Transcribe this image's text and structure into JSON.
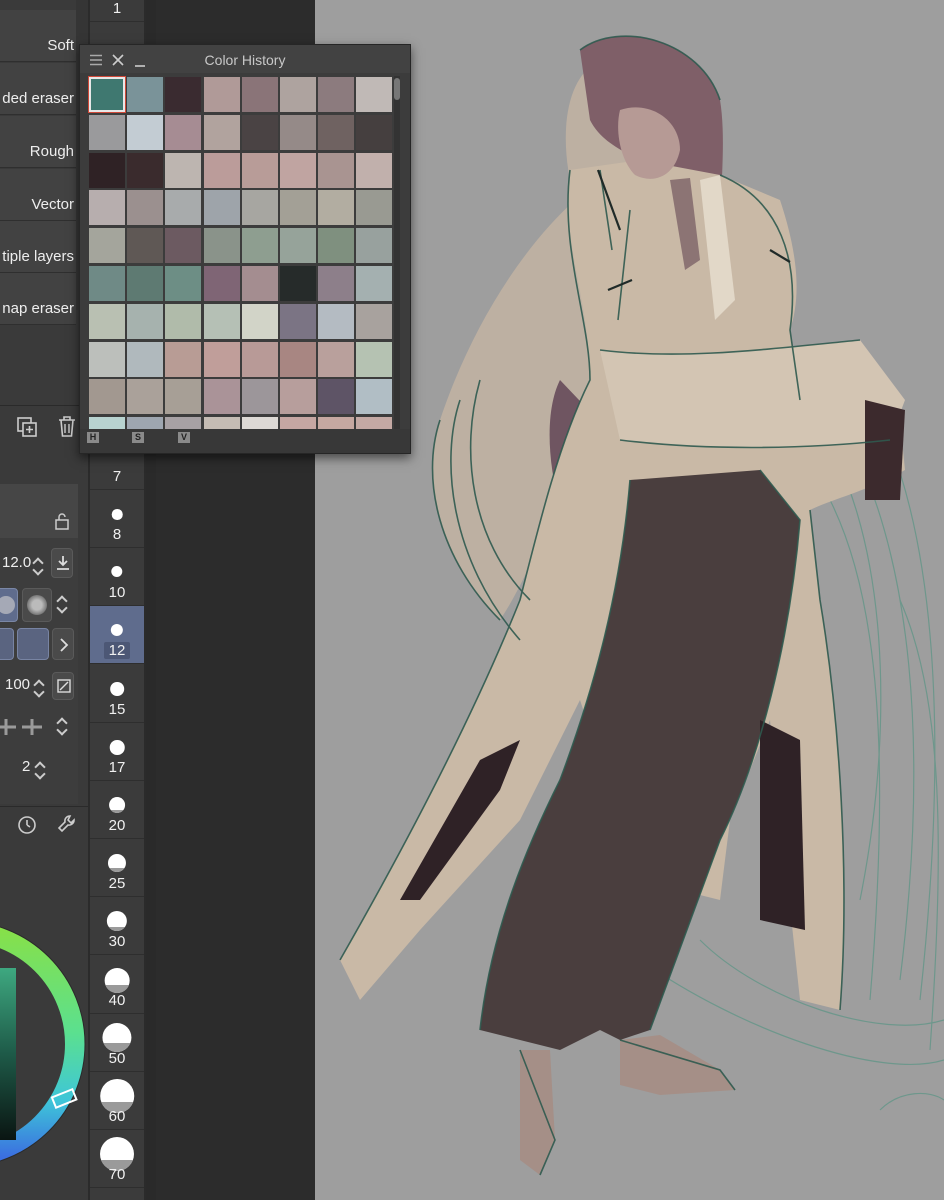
{
  "subtool_list": {
    "items": [
      {
        "label": "Soft"
      },
      {
        "label": "ded eraser"
      },
      {
        "label": "Rough"
      },
      {
        "label": "Vector"
      },
      {
        "label": "tiple layers"
      },
      {
        "label": "nap eraser"
      }
    ]
  },
  "color_history": {
    "title": "Color History",
    "footer_labels": [
      "H",
      "S",
      "V"
    ],
    "swatches": [
      [
        "#3f7870",
        "#7a9399",
        "#3a2b30",
        "#b09a98",
        "#8a7478",
        "#aea39f",
        "#8c7b7e",
        "#c0b9b6"
      ],
      [
        "#9a9a9c",
        "#c3ccd3",
        "#a68c93",
        "#b1a39e",
        "#4a4344",
        "#958a88",
        "#6f6261",
        "#453f3f"
      ],
      [
        "#2f2225",
        "#3a2b2d",
        "#bdb5b0",
        "#bb9c9a",
        "#b89c98",
        "#c0a4a1",
        "#a99491",
        "#c1b0ac"
      ],
      [
        "#b7aeae",
        "#9b908f",
        "#a8abac",
        "#9ea4aa",
        "#a7a6a1",
        "#a3a096",
        "#b2ada1",
        "#999a92"
      ],
      [
        "#a4a59c",
        "#5f5855",
        "#6c5a61",
        "#8a938a",
        "#8e9e90",
        "#96a39a",
        "#7f907f",
        "#98a19e"
      ],
      [
        "#6f8a86",
        "#5e7a72",
        "#6d8e85",
        "#7f6575",
        "#a48d90",
        "#262b2a",
        "#8d7f8a",
        "#a4b0b0"
      ],
      [
        "#b9c0b2",
        "#a6b2ae",
        "#b0bbaa",
        "#b5c0b5",
        "#d2d4c8",
        "#7b7484",
        "#b4bbc2",
        "#a8a29e"
      ],
      [
        "#bcbfbb",
        "#b0b9bd",
        "#b89c95",
        "#c09e9a",
        "#b89a97",
        "#a88682",
        "#b9a09c",
        "#b5c2b2"
      ],
      [
        "#a29890",
        "#aaa19a",
        "#a79f96",
        "#aa9398",
        "#9c969a",
        "#b79e9c",
        "#5e5466",
        "#b1bec5"
      ],
      [
        "#b8d3d0",
        "#9ea6b0",
        "#a7a1a4",
        "#c5bcb4",
        "#ddd9d5",
        "#c6a7a3",
        "#c6a8a1",
        "#c4a9a4"
      ]
    ]
  },
  "brush_sizes": [
    "1",
    "7",
    "8",
    "10",
    "12",
    "15",
    "17",
    "20",
    "25",
    "30",
    "40",
    "50",
    "60",
    "70"
  ],
  "selected_brush_size": "12",
  "tool_properties": {
    "size_value": "12.0",
    "opacity_value": "100",
    "stroke_value": "2"
  },
  "colors": {
    "panel_bg": "#3a3a3a",
    "canvas_bg": "#9e9e9e",
    "selection_blue": "#5f6c8d",
    "accent_red": "#d04a3a"
  }
}
